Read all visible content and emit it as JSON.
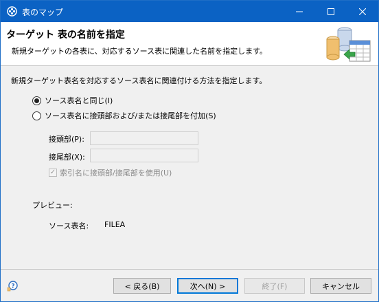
{
  "window": {
    "title": "表のマップ"
  },
  "header": {
    "title": "ターゲット 表の名前を指定",
    "description": "新規ターゲットの各表に、対応するソース表に関連した名前を指定します。"
  },
  "instruction": "新規ターゲット表名を対応するソース表名に関連付ける方法を指定します。",
  "options": [
    {
      "label": "ソース表名と同じ(I)",
      "selected": true
    },
    {
      "label": "ソース表名に接頭部および/または接尾部を付加(S)",
      "selected": false
    }
  ],
  "prefix": {
    "label": "接頭部(P):",
    "value": ""
  },
  "suffix": {
    "label": "接尾部(X):",
    "value": ""
  },
  "checkbox": {
    "label": "索引名に接頭部/接尾部を使用(U)",
    "checked": true,
    "enabled": false
  },
  "preview": {
    "label": "プレビュー:",
    "source_label": "ソース表名:",
    "source_value": "FILEA"
  },
  "buttons": {
    "back": "< 戻る(B)",
    "next": "次へ(N) >",
    "finish": "終了(F)",
    "cancel": "キャンセル"
  },
  "colors": {
    "titlebar": "#0b62c4",
    "accent": "#0078d7"
  },
  "icons": [
    "app-icon",
    "minimize-icon",
    "maximize-icon",
    "close-icon",
    "table-map-wizard-image",
    "help-icon"
  ]
}
